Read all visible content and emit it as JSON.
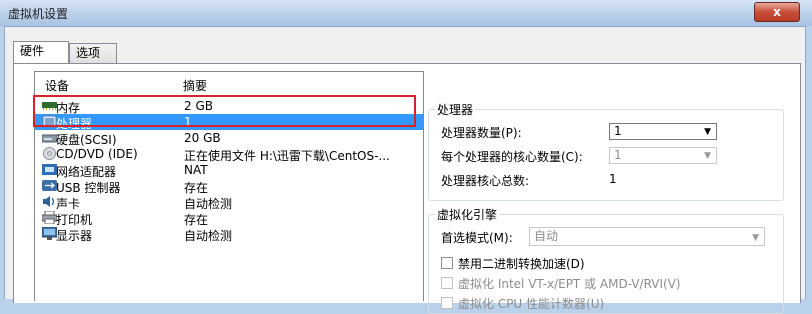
{
  "window": {
    "title": "虚拟机设置",
    "close_label": "x"
  },
  "tabs": [
    {
      "label": "硬件"
    },
    {
      "label": "选项"
    }
  ],
  "device_list": {
    "col_device": "设备",
    "col_summary": "摘要",
    "rows": [
      {
        "name": "内存",
        "summary": "2 GB",
        "icon": "memory-icon"
      },
      {
        "name": "处理器",
        "summary": "1",
        "icon": "processor-icon"
      },
      {
        "name": "硬盘(SCSI)",
        "summary": "20 GB",
        "icon": "hard-disk-icon"
      },
      {
        "name": "CD/DVD (IDE)",
        "summary": "正在使用文件 H:\\迅雷下载\\CentOS-...",
        "icon": "cd-dvd-icon"
      },
      {
        "name": "网络适配器",
        "summary": "NAT",
        "icon": "network-adapter-icon"
      },
      {
        "name": "USB 控制器",
        "summary": "存在",
        "icon": "usb-icon"
      },
      {
        "name": "声卡",
        "summary": "自动检测",
        "icon": "sound-card-icon"
      },
      {
        "name": "打印机",
        "summary": "存在",
        "icon": "printer-icon"
      },
      {
        "name": "显示器",
        "summary": "自动检测",
        "icon": "display-icon"
      }
    ]
  },
  "processor": {
    "group_title": "处理器",
    "count_label": "处理器数量(P):",
    "count_value": "1",
    "cores_label": "每个处理器的核心数量(C):",
    "cores_value": "1",
    "total_label": "处理器核心总数:",
    "total_value": "1"
  },
  "virtualization": {
    "group_title": "虚拟化引擎",
    "mode_label": "首选模式(M):",
    "mode_value": "自动",
    "disable_binary_translation": "禁用二进制转换加速(D)",
    "vtx_label": "虚拟化 Intel VT-x/EPT 或 AMD-V/RVI(V)",
    "cpu_counters_label": "虚拟化 CPU 性能计数器(U)"
  },
  "colors": {
    "selection": "#3399ff",
    "highlight_box": "#d8232a"
  }
}
